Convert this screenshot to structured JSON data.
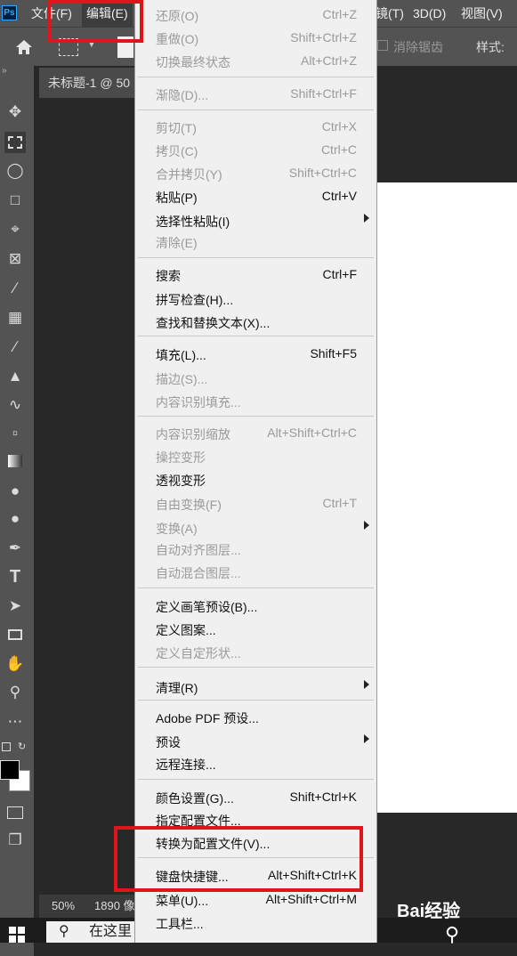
{
  "app": {
    "logo": "Ps"
  },
  "menubar": {
    "items": [
      "文件(F)",
      "编辑(E)",
      "镜(T)",
      "3D(D)",
      "视图(V)"
    ]
  },
  "options": {
    "anti_alias": "消除锯齿",
    "style": "样式:"
  },
  "document": {
    "tab_title": "未标题-1 @ 50",
    "zoom": "50%",
    "size": "1890 像"
  },
  "taskbar": {
    "search_placeholder": "在这里"
  },
  "edit_menu": {
    "items": [
      {
        "label": "还原(O)",
        "shortcut": "Ctrl+Z",
        "enabled": false
      },
      {
        "label": "重做(O)",
        "shortcut": "Shift+Ctrl+Z",
        "enabled": false
      },
      {
        "label": "切换最终状态",
        "shortcut": "Alt+Ctrl+Z",
        "enabled": false
      },
      {
        "label": "渐隐(D)...",
        "shortcut": "Shift+Ctrl+F",
        "enabled": false
      },
      {
        "label": "剪切(T)",
        "shortcut": "Ctrl+X",
        "enabled": false
      },
      {
        "label": "拷贝(C)",
        "shortcut": "Ctrl+C",
        "enabled": false
      },
      {
        "label": "合并拷贝(Y)",
        "shortcut": "Shift+Ctrl+C",
        "enabled": false
      },
      {
        "label": "粘贴(P)",
        "shortcut": "Ctrl+V",
        "enabled": true
      },
      {
        "label": "选择性粘贴(I)",
        "shortcut": "",
        "enabled": true,
        "submenu": true
      },
      {
        "label": "清除(E)",
        "shortcut": "",
        "enabled": false
      },
      {
        "label": "搜索",
        "shortcut": "Ctrl+F",
        "enabled": true
      },
      {
        "label": "拼写检查(H)...",
        "shortcut": "",
        "enabled": true
      },
      {
        "label": "查找和替换文本(X)...",
        "shortcut": "",
        "enabled": true
      },
      {
        "label": "填充(L)...",
        "shortcut": "Shift+F5",
        "enabled": true
      },
      {
        "label": "描边(S)...",
        "shortcut": "",
        "enabled": false
      },
      {
        "label": "内容识别填充...",
        "shortcut": "",
        "enabled": false
      },
      {
        "label": "内容识别缩放",
        "shortcut": "Alt+Shift+Ctrl+C",
        "enabled": false
      },
      {
        "label": "操控变形",
        "shortcut": "",
        "enabled": false
      },
      {
        "label": "透视变形",
        "shortcut": "",
        "enabled": true
      },
      {
        "label": "自由变换(F)",
        "shortcut": "Ctrl+T",
        "enabled": false
      },
      {
        "label": "变换(A)",
        "shortcut": "",
        "enabled": false,
        "submenu": true
      },
      {
        "label": "自动对齐图层...",
        "shortcut": "",
        "enabled": false
      },
      {
        "label": "自动混合图层...",
        "shortcut": "",
        "enabled": false
      },
      {
        "label": "定义画笔预设(B)...",
        "shortcut": "",
        "enabled": true
      },
      {
        "label": "定义图案...",
        "shortcut": "",
        "enabled": true
      },
      {
        "label": "定义自定形状...",
        "shortcut": "",
        "enabled": false
      },
      {
        "label": "清理(R)",
        "shortcut": "",
        "enabled": true,
        "submenu": true
      },
      {
        "label": "Adobe PDF 预设...",
        "shortcut": "",
        "enabled": true
      },
      {
        "label": "预设",
        "shortcut": "",
        "enabled": true,
        "submenu": true
      },
      {
        "label": "远程连接...",
        "shortcut": "",
        "enabled": true
      },
      {
        "label": "颜色设置(G)...",
        "shortcut": "Shift+Ctrl+K",
        "enabled": true
      },
      {
        "label": "指定配置文件...",
        "shortcut": "",
        "enabled": true
      },
      {
        "label": "转换为配置文件(V)...",
        "shortcut": "",
        "enabled": true
      },
      {
        "label": "键盘快捷键...",
        "shortcut": "Alt+Shift+Ctrl+K",
        "enabled": true
      },
      {
        "label": "菜单(U)...",
        "shortcut": "Alt+Shift+Ctrl+M",
        "enabled": true
      },
      {
        "label": "工具栏...",
        "shortcut": "",
        "enabled": true
      }
    ]
  },
  "watermark": {
    "text": "Bai经验"
  },
  "colors": {
    "annotation": "#e0141b",
    "menu_bg": "#f0f0f0",
    "app_bg": "#282828",
    "panel": "#535353"
  }
}
